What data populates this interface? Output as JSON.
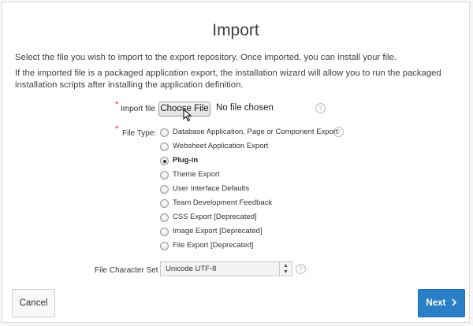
{
  "page": {
    "title": "Import",
    "description_1": "Select the file you wish to import to the export repository. Once imported, you can install your file.",
    "description_2": "If the imported file is a packaged application export, the installation wizard will allow you to run the packaged installation scripts after installing the application definition."
  },
  "import_file": {
    "label": "Import file",
    "button_label": "Choose File",
    "status": "No file chosen",
    "help_icon": "help-icon"
  },
  "file_type": {
    "label": "File Type:",
    "options": [
      {
        "label": "Database Application, Page or Component Export",
        "checked": false
      },
      {
        "label": "Websheet Application Export",
        "checked": false
      },
      {
        "label": "Plug-in",
        "checked": true
      },
      {
        "label": "Theme Export",
        "checked": false
      },
      {
        "label": "User Interface Defaults",
        "checked": false
      },
      {
        "label": "Team Development Feedback",
        "checked": false
      },
      {
        "label": "CSS Export [Deprecated]",
        "checked": false
      },
      {
        "label": "Image Export [Deprecated]",
        "checked": false
      },
      {
        "label": "File Export [Deprecated]",
        "checked": false
      }
    ],
    "help_icon": "help-icon"
  },
  "charset": {
    "label": "File Character Set",
    "value": "Unicode UTF-8",
    "help_icon": "help-icon"
  },
  "footer": {
    "cancel_label": "Cancel",
    "next_label": "Next",
    "next_icon": "chevron-right-icon"
  },
  "colors": {
    "primary": "#2a7fc6",
    "required_star": "#e22222"
  }
}
